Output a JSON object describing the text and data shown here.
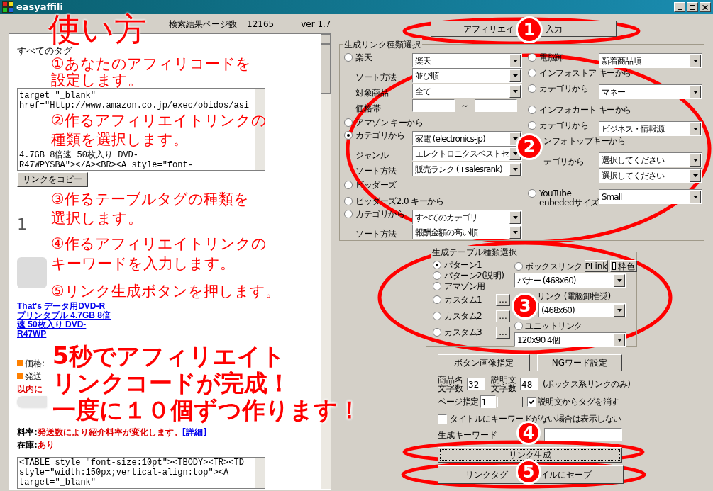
{
  "window": {
    "title": "easyaffili"
  },
  "status": {
    "pages_label": "検索結果ページ数",
    "pages": "12165",
    "version": "ver 1.7"
  },
  "preview": {
    "heading": "すべてのタグ",
    "code_top": [
      "target=\"_blank\"",
      "href=\"Http://www.amazon.co.jp/exec/obidos/asi"
    ],
    "code_top_tail": [
      "4.7GB 8倍速 50枚入り DVD-",
      "R47WPYSBA\"></A><BR><A style=\"font-"
    ],
    "copy_button": "リンクをコピー",
    "index": "1",
    "product_link": "That's データ用DVD-R プリンタブル 4.7GB 8倍速 50枚入り DVD-R47WP",
    "price_label": "価格:",
    "shipping_label": "発送",
    "shipping_note": "以内に",
    "rate_label": "料率:",
    "rate": "発送数により紹介料率が変化します。",
    "rate_link": "[詳細]",
    "stock_label": "在庫:",
    "stock": "あり",
    "code_bottom": [
      "<TABLE style=\"font-size:10pt\"><TBODY><TR><TD",
      "style=\"width:150px;vertical-align:top\"><A",
      "target=\"_blank\""
    ]
  },
  "affiliate_button": {
    "start": "アフィリエイ",
    "end": "入力"
  },
  "link_group": {
    "title": "生成リンク種類選択",
    "left": [
      {
        "kind": "radio",
        "label": "楽天",
        "selected": false,
        "value": "楽天"
      },
      {
        "kind": "field",
        "label": "ソート方法",
        "value": "並び順"
      },
      {
        "kind": "field",
        "label": "対象商品",
        "value": "全て"
      },
      {
        "kind": "range",
        "label": "価格帯",
        "separator": "～"
      },
      {
        "kind": "radio",
        "label": "アマゾン キーから",
        "selected": false
      },
      {
        "kind": "radio",
        "label": "カテゴリから",
        "selected": true,
        "value": "家電 (electronics-jp)"
      },
      {
        "kind": "field",
        "label": "ジャンル",
        "value": "エレクトロニクスベストセ"
      },
      {
        "kind": "field",
        "label": "ソート方法",
        "value": "販売ランク (+salesrank)"
      },
      {
        "kind": "radio",
        "label": "ビッダーズ",
        "selected": false
      },
      {
        "kind": "radio",
        "label": "ビッダーズ2.0 キーから",
        "selected": false
      },
      {
        "kind": "radio",
        "label": "カテゴリから",
        "selected": false,
        "value": "すべてのカテゴリ"
      },
      {
        "kind": "field",
        "label": "ソート方法",
        "value": "報酬金額の高い順"
      }
    ],
    "right": [
      {
        "kind": "radio",
        "label": "電脳卸",
        "selected": false,
        "value": "新着商品順"
      },
      {
        "kind": "radio",
        "label": "インフォストア キーから",
        "selected": false
      },
      {
        "kind": "radio",
        "label": "カテゴリから",
        "selected": false,
        "value": "マネー"
      },
      {
        "kind": "radio",
        "label": "インフォカート キーから",
        "selected": false
      },
      {
        "kind": "radio",
        "label": "カテゴリから",
        "selected": false,
        "value": "ビジネス・情報源"
      },
      {
        "kind": "text",
        "label": "ンフォトップキーから"
      },
      {
        "kind": "field",
        "label": "テゴリから",
        "value": "選択してください"
      },
      {
        "kind": "field",
        "value": "選択してください"
      },
      {
        "kind": "radio",
        "label": "YouTube enbededサイズ",
        "selected": false,
        "value": "Small"
      }
    ]
  },
  "table_group": {
    "title": "生成テーブル種類選択",
    "patterns": [
      {
        "label": "パターン1",
        "selected": true
      },
      {
        "label": "パターン2(説明)",
        "selected": false
      },
      {
        "label": "アマゾン用",
        "selected": false
      },
      {
        "label": "カスタム1",
        "selected": false,
        "button": "..."
      },
      {
        "label": "カスタム2",
        "selected": false,
        "button": "..."
      },
      {
        "label": "カスタム3",
        "selected": false,
        "button": "..."
      }
    ],
    "links": [
      {
        "label": "ボックスリンク",
        "selected": false,
        "value": "バナー (468x60)"
      },
      {
        "label": "リンク (電脳卸推奨)",
        "value": "(468x60)"
      },
      {
        "label": "ユニットリンク",
        "selected": false,
        "value": "120x90 4個"
      }
    ],
    "plink_button": "PLink",
    "frame_color_button": "枠色"
  },
  "image_button": "ボタン画像指定",
  "ng_button": "NGワード設定",
  "name_len": {
    "label": "商品名文字数",
    "value": "32"
  },
  "desc_len": {
    "label": "説明文文字数",
    "value": "48"
  },
  "box_note": "(ボックス系リンクのみ)",
  "page": {
    "label": "ページ指定",
    "value": "1"
  },
  "strip_tags": {
    "label": "説明文からタグを消す",
    "checked": true
  },
  "hide_no_keyword": {
    "label": "タイトルにキーワードがない場合は表示しない",
    "checked": false
  },
  "keyword": {
    "label": "生成キーワード"
  },
  "generate_button": "リンク生成",
  "save_button": {
    "start": "リンクタグ",
    "end": "イルにセーブ"
  },
  "guide": {
    "title": "使い方",
    "steps": [
      [
        "①あなたのアフィリコードを",
        "設定します。"
      ],
      [
        "②作るアフィリエイトリンクの",
        "種類を選択します。"
      ],
      [
        "③作るテーブルタグの種類を",
        "選択します。"
      ],
      [
        "④作るアフィリエイトリンクの",
        "キーワードを入力します。"
      ],
      [
        "⑤リンク生成ボタンを押します。"
      ]
    ],
    "headline": [
      "5秒でアフィリエイト",
      "リンクコードが完成！",
      "一度に１０個ずつ作ります！"
    ],
    "markers": [
      "1",
      "2",
      "3",
      "4",
      "5"
    ]
  }
}
